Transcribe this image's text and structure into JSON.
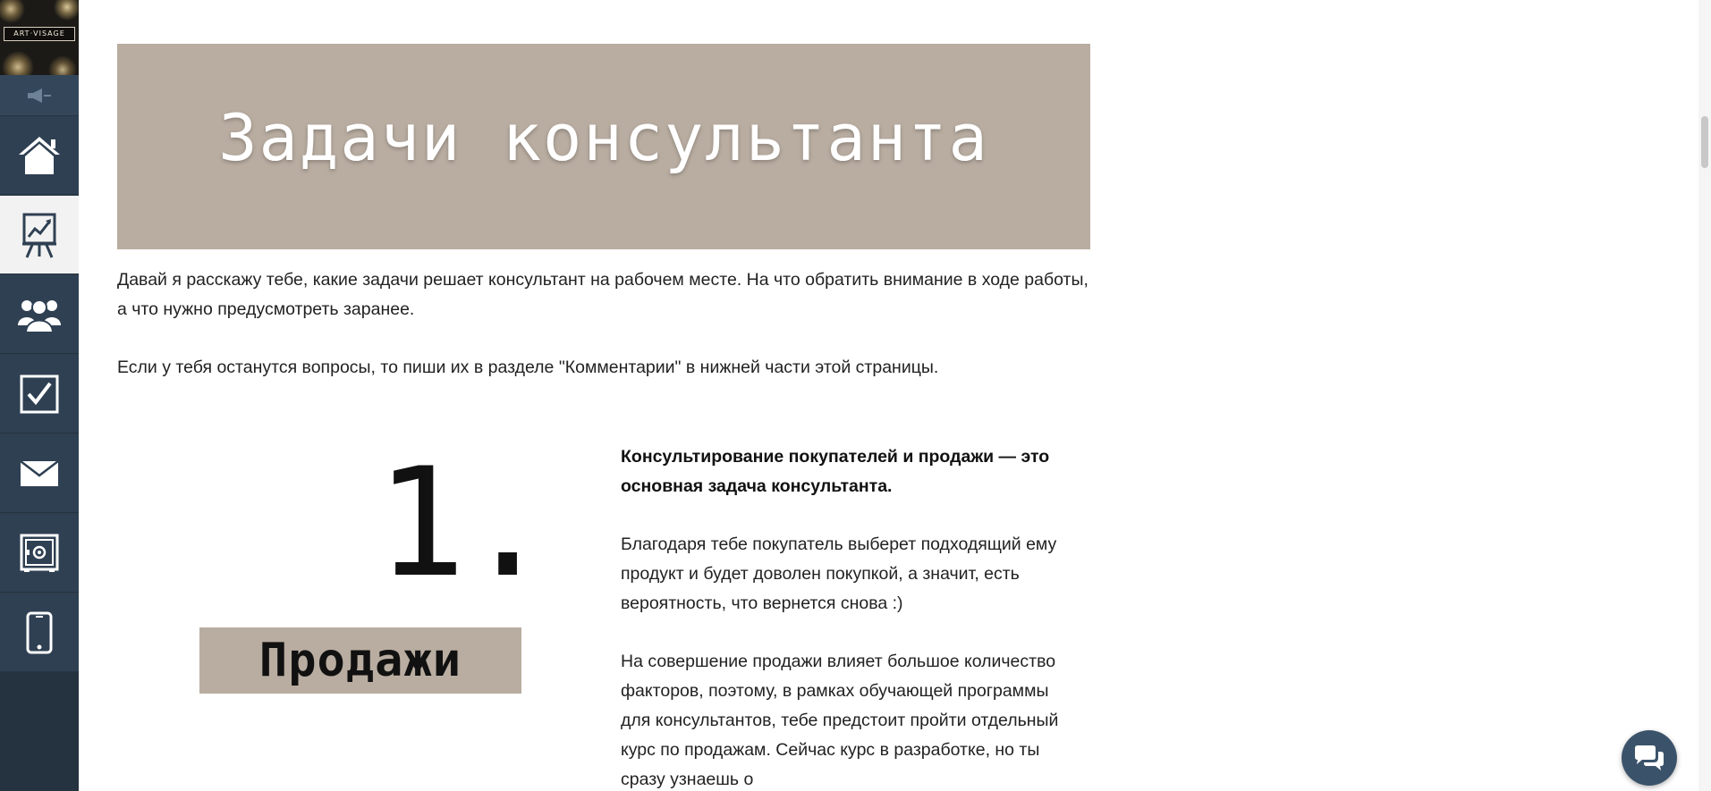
{
  "sidebar": {
    "logo_text": "ART·VISAGE",
    "items": [
      {
        "icon": "home-icon"
      },
      {
        "icon": "chart-board-icon",
        "active": true
      },
      {
        "icon": "users-icon"
      },
      {
        "icon": "checkbox-icon"
      },
      {
        "icon": "mail-icon"
      },
      {
        "icon": "safe-icon"
      },
      {
        "icon": "phone-icon"
      }
    ]
  },
  "banner": {
    "title": "Задачи консультанта"
  },
  "intro": {
    "paragraph_1": "Давай я расскажу тебе, какие задачи решает консультант на рабочем месте. На что обратить внимание в ходе работы, а что нужно предусмотреть заранее.",
    "paragraph_2": "Если у тебя останутся вопросы, то пиши их в разделе \"Комментарии\" в нижней части этой страницы."
  },
  "section_1": {
    "number": "1.",
    "label": "Продажи",
    "heading": "Консультирование покупателей и продажи — это основная задача консультанта.",
    "paragraph_1": "Благодаря тебе покупатель выберет подходящий ему продукт и будет доволен покупкой, а значит, есть вероятность, что вернется снова :)",
    "paragraph_2": "На совершение продажи влияет большое количество факторов, поэтому, в рамках обучающей программы для консультантов, тебе предстоит пройти отдельный курс по продажам. Сейчас курс в разработке, но ты сразу узнаешь о"
  },
  "colors": {
    "sidebar": "#2f3e4d",
    "accent_beige": "#b9ada1",
    "chat_button": "#3b536a"
  }
}
